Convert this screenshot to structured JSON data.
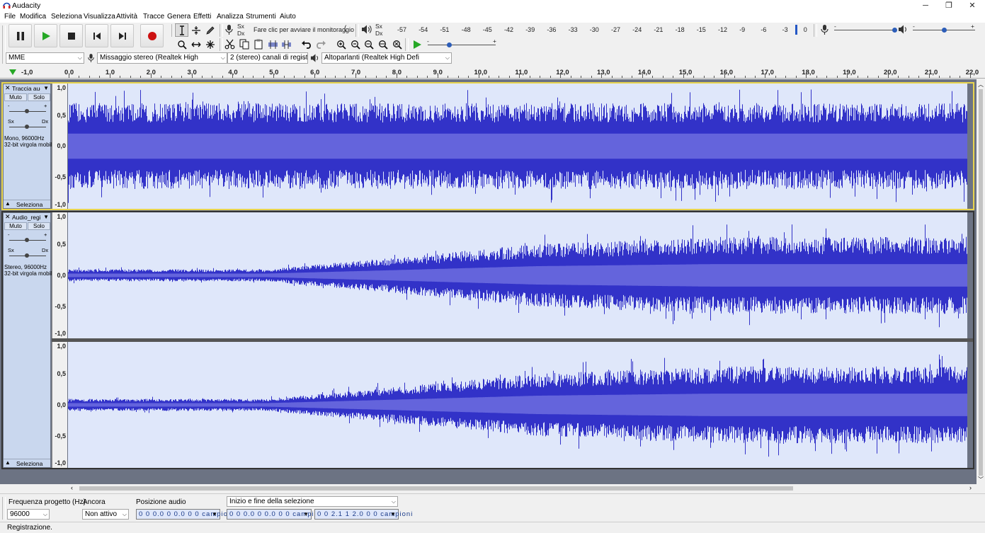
{
  "window": {
    "title": "Audacity",
    "minimize": "─",
    "maximize": "❐",
    "close": "✕"
  },
  "menu": [
    "File",
    "Modifica",
    "Seleziona",
    "Visualizza",
    "Attività",
    "Tracce",
    "Genera",
    "Effetti",
    "Analizza",
    "Strumenti",
    "Aiuto"
  ],
  "transport": {
    "pause": "Pausa",
    "play": "Riproduci",
    "stop": "Ferma",
    "skip_start": "Salta all'inizio",
    "skip_end": "Salta alla fine",
    "record": "Registra"
  },
  "meter": {
    "rec_lr": [
      "Sx",
      "Dx"
    ],
    "play_lr": [
      "Sx",
      "Dx"
    ],
    "monitor_hint": "Fare clic per avviare il monitoraggio",
    "rec_scale": [
      "-57",
      "-54",
      "-51",
      "-48",
      "-45",
      "-42",
      "-39",
      "-36",
      "-33",
      "-30",
      "-27",
      "-24",
      "-21",
      "-18",
      "-15",
      "-12",
      "-9",
      "-6",
      "-3",
      "0"
    ]
  },
  "mixer": {
    "minus": "-",
    "plus": "+"
  },
  "device": {
    "host": "MME",
    "recording_device": "Missaggio stereo (Realtek High",
    "channels": "2 (stereo) canali di registr",
    "playback_device": "Altoparlanti (Realtek High Defi"
  },
  "timeline": {
    "start_label": "-1,0",
    "ticks": [
      "0,0",
      "1,0",
      "2,0",
      "3,0",
      "4,0",
      "5,0",
      "6,0",
      "7,0",
      "8,0",
      "9,0",
      "10,0",
      "11,0",
      "12,0",
      "13,0",
      "14,0",
      "15,0",
      "16,0",
      "17,0",
      "18,0",
      "19,0",
      "20,0",
      "21,0",
      "22,0"
    ]
  },
  "tracks": [
    {
      "name": "Traccia audi",
      "mute": "Muto",
      "solo": "Solo",
      "gain_minus": "-",
      "gain_plus": "+",
      "pan_left": "Sx",
      "pan_right": "Dx",
      "info_line1": "Mono, 96000Hz",
      "info_line2": "32-bit virgola mobile",
      "select": "Seleziona",
      "scale": [
        "1,0",
        "0,5",
        "0,0",
        "-0,5",
        "-1,0"
      ]
    },
    {
      "name": "Audio_regist",
      "mute": "Muto",
      "solo": "Solo",
      "gain_minus": "-",
      "gain_plus": "+",
      "pan_left": "Sx",
      "pan_right": "Dx",
      "info_line1": "Stereo, 96000Hz",
      "info_line2": "32-bit virgola mobile",
      "select": "Seleziona",
      "scale_left": [
        "1,0",
        "0,5",
        "0,0",
        "-0,5",
        "-1,0"
      ],
      "scale_right": [
        "1,0",
        "0,5",
        "0,0",
        "-0,5",
        "-1,0"
      ]
    }
  ],
  "selection_bar": {
    "rate_label": "Frequenza progetto (Hz)",
    "rate_value": "96000",
    "snap_label": "Ancora",
    "snap_value": "Non attivo",
    "position_label": "Posizione audio",
    "position_value": "0 0 0.0 0 0.0 0 0 campioni",
    "range_label": "Inizio e fine della selezione",
    "start_value": "0 0 0.0 0 0.0 0 0 campioni",
    "end_value": "0 0 2.1 1 2.0 0 0 campioni"
  },
  "status": "Registrazione.",
  "colors": {
    "wave_fill": "#3232c8",
    "wave_rms": "#6464dc",
    "wave_bg": "#dfe7fa",
    "track_bg": "#c9d7ee",
    "record_red": "#cc1111",
    "play_green": "#26a826"
  }
}
